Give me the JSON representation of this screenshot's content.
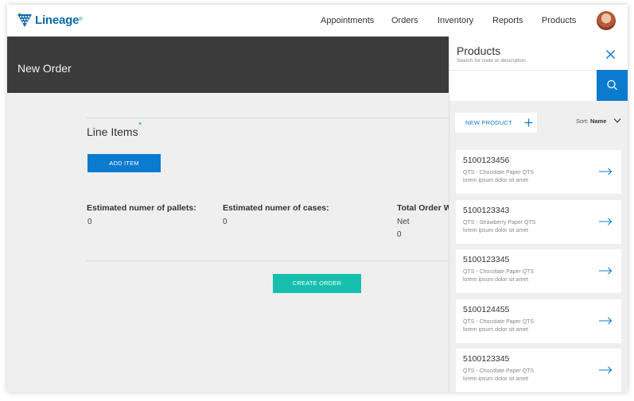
{
  "brand": {
    "name": "Lineage",
    "color": "#0a6aa8"
  },
  "nav": {
    "items": [
      "Appointments",
      "Orders",
      "Inventory",
      "Reports",
      "Products"
    ]
  },
  "page": {
    "title": "New Order"
  },
  "line_items": {
    "title": "Line Items",
    "required_mark": "*",
    "add_button": "ADD ITEM",
    "stats": [
      {
        "label": "Estimated numer of pallets:",
        "value": "0"
      },
      {
        "label": "Estimated numer of cases:",
        "value": "0"
      },
      {
        "label": "Total Order W",
        "sub": "Net",
        "value": "0"
      }
    ],
    "create_button": "CREATE ORDER"
  },
  "panel": {
    "title": "Products",
    "subtitle": "Search for code or description",
    "search": {
      "value": "",
      "placeholder": ""
    },
    "new_product_label": "NEW PRODUCT",
    "sort": {
      "label": "Sort:",
      "value": "Name"
    },
    "products": [
      {
        "code": "5100123456",
        "name": "QTS - Chocolate Paper QTS",
        "desc": "lorem ipsum dolor sit amet"
      },
      {
        "code": "5100123343",
        "name": "QTS - Strawberry Paper QTS",
        "desc": "lorem ipsum dolor sit amet"
      },
      {
        "code": "5100123345",
        "name": "QTS - Chocolate Paper QTS",
        "desc": "lorem ipsum dolor sit amet"
      },
      {
        "code": "5100124455",
        "name": "QTS - Chocolate Paper QTS",
        "desc": "lorem ipsum dolor sit amet"
      },
      {
        "code": "5100123345",
        "name": "QTS - Chocolate Paper QTS",
        "desc": "lorem ipsum dolor sit amet"
      }
    ]
  },
  "colors": {
    "primary_blue": "#0b7bd0",
    "teal": "#17bfae",
    "header_dark": "#3b3b3b",
    "panel_bg": "#efefef"
  },
  "icons": [
    "lineage-logo-icon",
    "avatar",
    "close-icon",
    "search-icon",
    "plus-icon",
    "chevron-down-icon",
    "arrow-right-icon"
  ]
}
